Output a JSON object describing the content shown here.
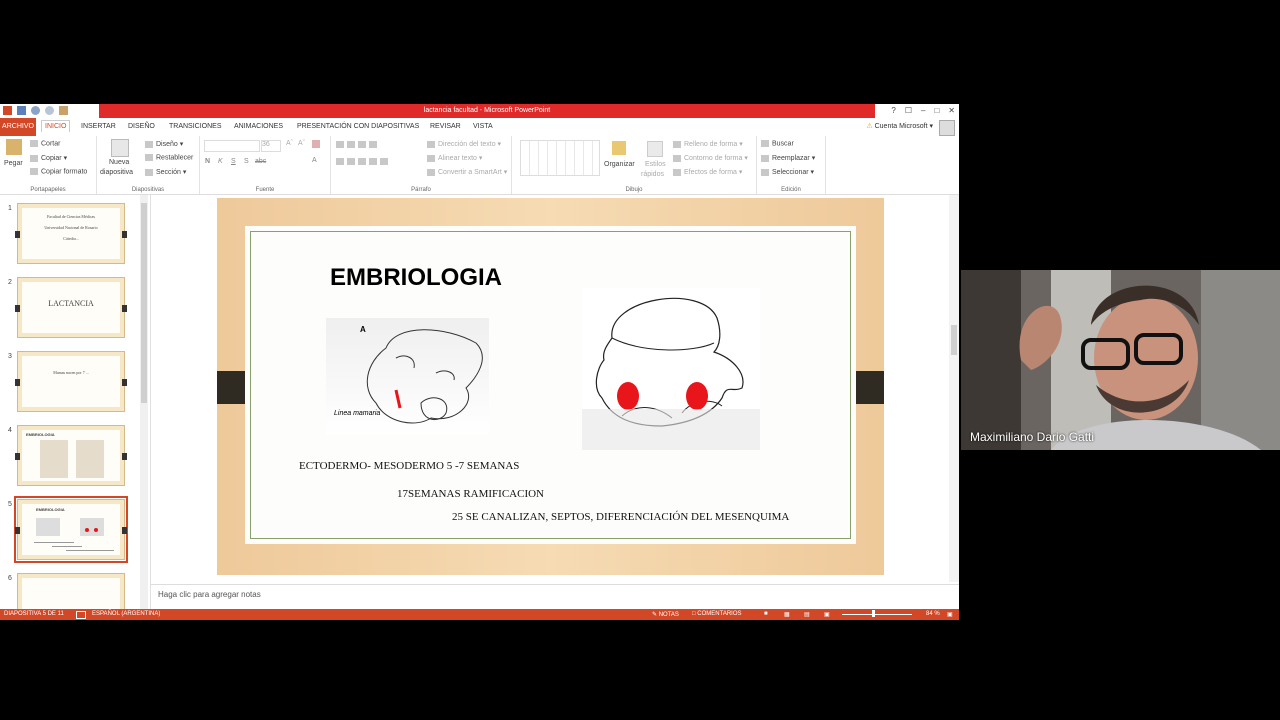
{
  "window": {
    "title": "lactancia facultad - Microsoft PowerPoint",
    "help": "?",
    "controls": [
      "☐",
      "–",
      "□",
      "✕"
    ]
  },
  "tabs": [
    "ARCHIVO",
    "INICIO",
    "INSERTAR",
    "DISEÑO",
    "TRANSICIONES",
    "ANIMACIONES",
    "PRESENTACIÓN CON DIAPOSITIVAS",
    "REVISAR",
    "VISTA"
  ],
  "account": "Cuenta Microsoft",
  "ribbon": {
    "portapapeles": {
      "pegar": "Pegar",
      "cortar": "Cortar",
      "copiar": "Copiar",
      "copiar_formato": "Copiar formato",
      "label": "Portapapeles"
    },
    "diapositivas": {
      "nueva": "Nueva",
      "nueva2": "diapositiva",
      "diseno": "Diseño",
      "restablecer": "Restablecer",
      "seccion": "Sección",
      "label": "Diapositivas"
    },
    "fuente": {
      "size": "36",
      "label": "Fuente",
      "buttons": [
        "N",
        "K",
        "S",
        "S",
        "abc"
      ]
    },
    "parrafo": {
      "direccion": "Dirección del texto",
      "alinear": "Alinear texto",
      "smartart": "Convertir a SmartArt",
      "label": "Párrafo"
    },
    "dibujo": {
      "organizar": "Organizar",
      "estilos": "Estilos",
      "rapidos": "rápidos",
      "relleno": "Relleno de forma",
      "contorno": "Contorno de forma",
      "efectos": "Efectos de forma",
      "label": "Dibujo"
    },
    "edicion": {
      "buscar": "Buscar",
      "reemplazar": "Reemplazar",
      "seleccionar": "Seleccionar",
      "label": "Edición"
    }
  },
  "thumbnails": [
    {
      "num": "1",
      "lines": [
        "Facultad de Ciencias Médicas",
        "Universidad Nacional de Rosario",
        "Cátedra..."
      ]
    },
    {
      "num": "2",
      "lines": [
        "LACTANCIA"
      ]
    },
    {
      "num": "3",
      "lines": [
        "Mamas nacen por 7 ..."
      ]
    },
    {
      "num": "4",
      "lines": [
        "EMBRIOLOGIA"
      ]
    },
    {
      "num": "5",
      "lines": [
        "EMBRIOLOGIA"
      ]
    },
    {
      "num": "6",
      "lines": []
    }
  ],
  "slide": {
    "title": "EMBRIOLOGIA",
    "figure_left_label_a": "A",
    "figure_left_label": "Linea mamaria",
    "line1": "ECTODERMO- MESODERMO 5 -7 SEMANAS",
    "line2": "17SEMANAS RAMIFICACION",
    "line3": "25 SE CANALIZAN,  SEPTOS, DIFERENCIACIÓN DEL MESENQUIMA"
  },
  "notes_placeholder": "Haga clic para agregar notas",
  "status": {
    "slide": "DIAPOSITIVA 5 DE 11",
    "language": "ESPAÑOL (ARGENTINA)",
    "notes": "NOTAS",
    "comments": "COMENTARIOS",
    "zoom": "84 %"
  },
  "participant": {
    "name": "Maximiliano Dario Gatti"
  },
  "colors": {
    "accent": "#d24726",
    "titlebar": "#e02a2a",
    "slide_bg": "#ecc28a",
    "dot_red": "#e8161b"
  }
}
